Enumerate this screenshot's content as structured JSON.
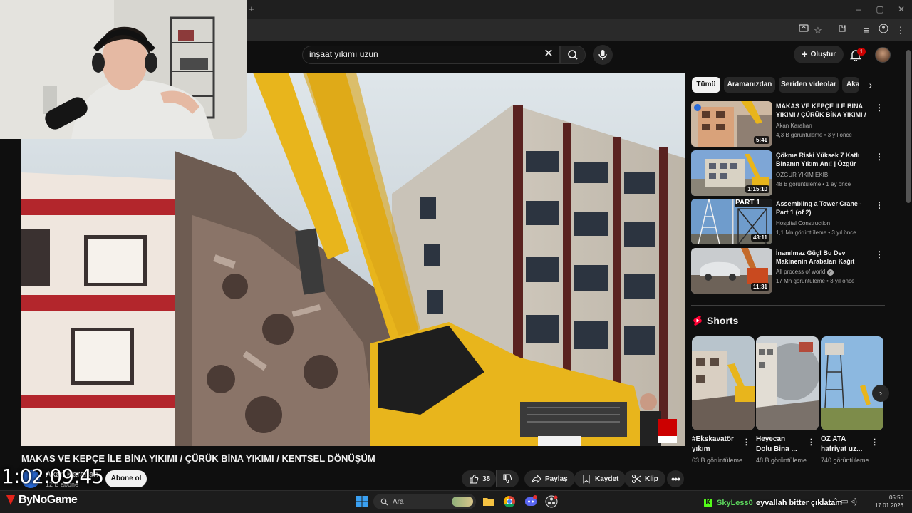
{
  "browser": {
    "new_tab": "+",
    "window_controls": [
      "–",
      "▢",
      "✕"
    ]
  },
  "header": {
    "search_query": "inşaat yıkımı uzun",
    "create_label": "Oluştur",
    "notification_count": "1"
  },
  "video": {
    "title": "MAKAS VE KEPÇE İLE BİNA YIKIMI / ÇÜRÜK BİNA YIKIMI / KENTSEL DÖNÜŞÜM",
    "channel_name": "Akan Karahan",
    "subscribers": "12 B abone",
    "subscribe_label": "Abone ol",
    "likes": "38",
    "share_label": "Paylaş",
    "save_label": "Kaydet",
    "clip_label": "Klip"
  },
  "overlay": {
    "stream_timer": "1:02:09:45"
  },
  "sidebar": {
    "chips": [
      "Tümü",
      "Aramanızdan",
      "Seriden videolar",
      "Akan"
    ],
    "recommendations": [
      {
        "title": "MAKAS VE KEPÇE İLE BİNA YIKIMI / ÇÜRÜK BİNA YIKIMI / ...",
        "channel": "Akan Karahan",
        "stats": "4,3 B görüntüleme • 3 yıl önce",
        "duration": "5:41"
      },
      {
        "title": "Çökme Riski Yüksek 7 Katlı Binanın Yıkım Anı! | Özgür Yık...",
        "channel": "ÖZGÜR YIKIM EKİBİ",
        "stats": "48 B görüntüleme • 1 ay önce",
        "duration": "1:15:10"
      },
      {
        "title": "Assembling a Tower Crane - Part 1 (of 2)",
        "channel": "Hospital Construction",
        "stats": "1,1 Mn görüntüleme • 3 yıl önce",
        "duration": "43:11",
        "thumb_label": "PART 1"
      },
      {
        "title": "İnanılmaz Güç! Bu Dev Makinenin Arabaları Kağıt Gibi...",
        "channel": "All process of world",
        "stats": "17 Mn görüntüleme • 3 yıl önce",
        "duration": "11:31"
      }
    ],
    "shorts_title": "Shorts",
    "shorts": [
      {
        "title": "#Ekskavatör yıkım",
        "views": "63 B görüntüleme"
      },
      {
        "title": "Heyecan Dolu Bina ...",
        "views": "48 B görüntüleme"
      },
      {
        "title": "ÖZ ATA hafriyat uz...",
        "views": "740 görüntüleme"
      }
    ]
  },
  "taskbar": {
    "brand": "ByNoGame",
    "search_placeholder": "Ara",
    "chat_user": "SkyLess0",
    "chat_message": "eyvallah bitter çıkl̇atam",
    "time": "05:56",
    "date": "17.01.2026"
  },
  "colors": {
    "background": "#0f0f0f",
    "surface": "#272727",
    "accent_red": "#cc0000",
    "excavator_yellow": "#e8b51c"
  }
}
